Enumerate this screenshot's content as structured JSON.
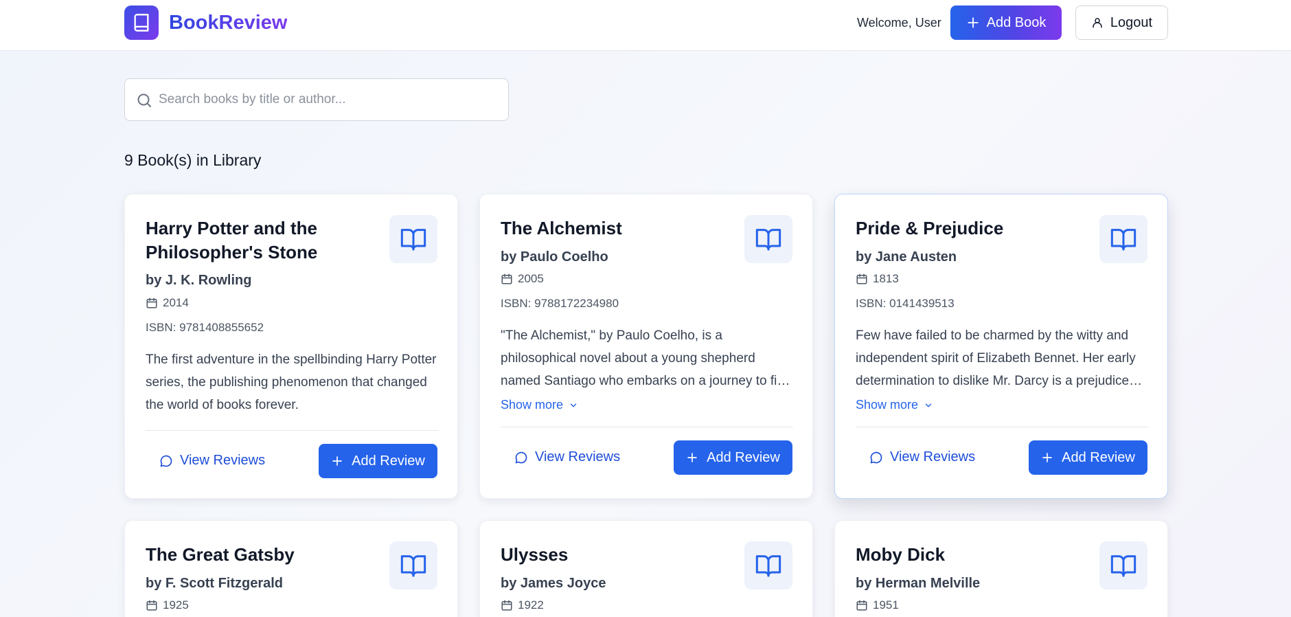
{
  "header": {
    "app_name": "BookReview",
    "welcome_text": "Welcome, User",
    "add_book_label": "Add Book",
    "logout_label": "Logout"
  },
  "search": {
    "placeholder": "Search books by title or author...",
    "value": ""
  },
  "library": {
    "count_text": "9 Book(s) in Library",
    "books": [
      {
        "title": "Harry Potter and the Philosopher's Stone",
        "author": "by J. K. Rowling",
        "year": "2014",
        "isbn": "ISBN: 9781408855652",
        "description": "The first adventure in the spellbinding Harry Potter series, the publishing phenomenon that changed the world of books forever.",
        "show_more": "",
        "view_reviews": "View Reviews",
        "add_review": "Add Review"
      },
      {
        "title": "The Alchemist",
        "author": "by Paulo Coelho",
        "year": "2005",
        "isbn": "ISBN: 9788172234980",
        "description": "\"The Alchemist,\" by Paulo Coelho, is a philosophical novel about a young shepherd named Santiago who embarks on a journey to find a treasure he has dreamed about.",
        "show_more": "Show more",
        "view_reviews": "View Reviews",
        "add_review": "Add Review"
      },
      {
        "title": "Pride & Prejudice",
        "author": "by Jane Austen",
        "year": "1813",
        "isbn": "ISBN: 0141439513",
        "description": "Few have failed to be charmed by the witty and independent spirit of Elizabeth Bennet. Her early determination to dislike Mr. Darcy is a prejudice only matched by his pride.",
        "show_more": "Show more",
        "view_reviews": "View Reviews",
        "add_review": "Add Review"
      },
      {
        "title": "The Great Gatsby",
        "author": "by F. Scott Fitzgerald",
        "year": "1925"
      },
      {
        "title": "Ulysses",
        "author": "by James Joyce",
        "year": "1922"
      },
      {
        "title": "Moby Dick",
        "author": "by Herman Melville",
        "year": "1951"
      }
    ]
  },
  "icons": {
    "logo": "book-icon",
    "add": "plus-icon",
    "logout": "user-icon",
    "search": "search-icon",
    "card": "book-open-icon",
    "year": "calendar-icon",
    "show_more": "chevron-down-icon",
    "reviews": "message-circle-icon"
  },
  "colors": {
    "primary": "#2563eb",
    "gradient_start": "#2563eb",
    "gradient_end": "#7c3aed",
    "icon_tile": "#eef2fb"
  }
}
